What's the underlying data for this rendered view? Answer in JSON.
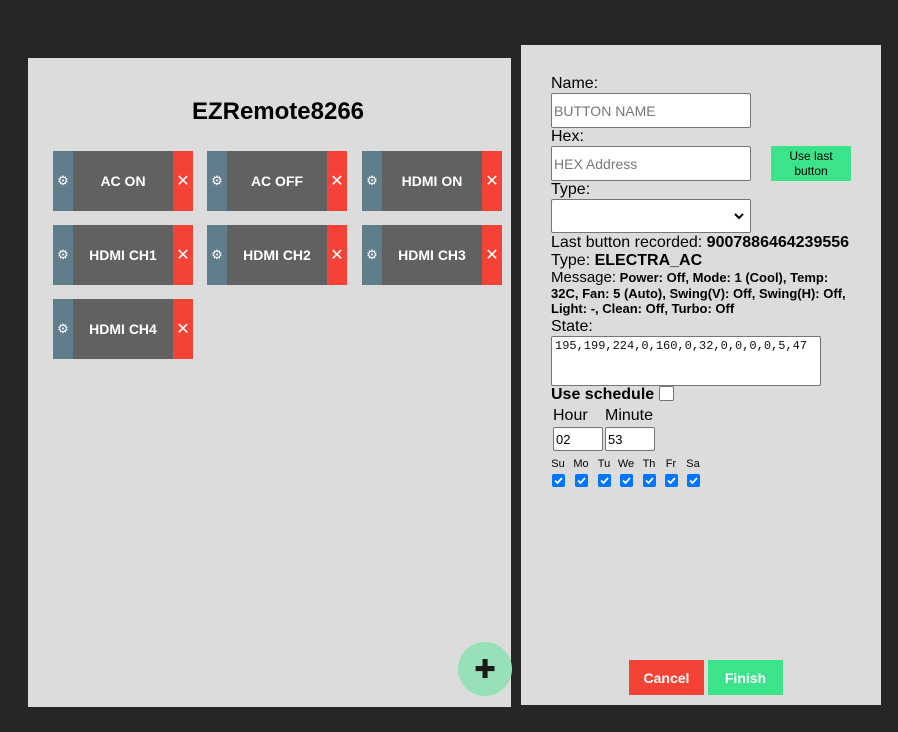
{
  "app": {
    "title": "EZRemote8266"
  },
  "icons": {
    "gear": "⚙",
    "delete": "✕",
    "add": "✚"
  },
  "remote_buttons": [
    {
      "label": "AC ON"
    },
    {
      "label": "AC OFF"
    },
    {
      "label": "HDMI ON"
    },
    {
      "label": "HDMI CH1"
    },
    {
      "label": "HDMI CH2"
    },
    {
      "label": "HDMI CH3"
    },
    {
      "label": "HDMI CH4"
    }
  ],
  "form": {
    "name_label": "Name:",
    "name_placeholder": "BUTTON NAME",
    "hex_label": "Hex:",
    "hex_placeholder": "HEX Address",
    "use_last_label": "Use last button",
    "type_label": "Type:",
    "type_value": "",
    "last_recorded_label": "Last button recorded:",
    "last_recorded_value": "9007886464239556",
    "type_info_label": "Type:",
    "type_info_value": "ELECTRA_AC",
    "message_label": "Message:",
    "message_value": "Power: Off, Mode: 1 (Cool), Temp: 32C, Fan: 5 (Auto), Swing(V): Off, Swing(H): Off, Light: -, Clean: Off, Turbo: Off",
    "state_label": "State:",
    "state_value": "195,199,224,0,160,0,32,0,0,0,0,5,47",
    "use_schedule_label": "Use schedule",
    "use_schedule_checked": false,
    "hour_label": "Hour",
    "hour_value": "02",
    "minute_label": "Minute",
    "minute_value": "53",
    "days": [
      {
        "label": "Su",
        "checked": true
      },
      {
        "label": "Mo",
        "checked": true
      },
      {
        "label": "Tu",
        "checked": true
      },
      {
        "label": "We",
        "checked": true
      },
      {
        "label": "Th",
        "checked": true
      },
      {
        "label": "Fr",
        "checked": true
      },
      {
        "label": "Sa",
        "checked": true
      }
    ],
    "cancel_label": "Cancel",
    "finish_label": "Finish"
  },
  "colors": {
    "background": "#262626",
    "panel": "#dcdcdc",
    "button_body": "#616161",
    "gear_strip": "#607d8b",
    "delete_strip": "#f44336",
    "accent_green": "#3be38a",
    "fab": "#98e1b8",
    "checkbox_blue": "#0075ff"
  }
}
